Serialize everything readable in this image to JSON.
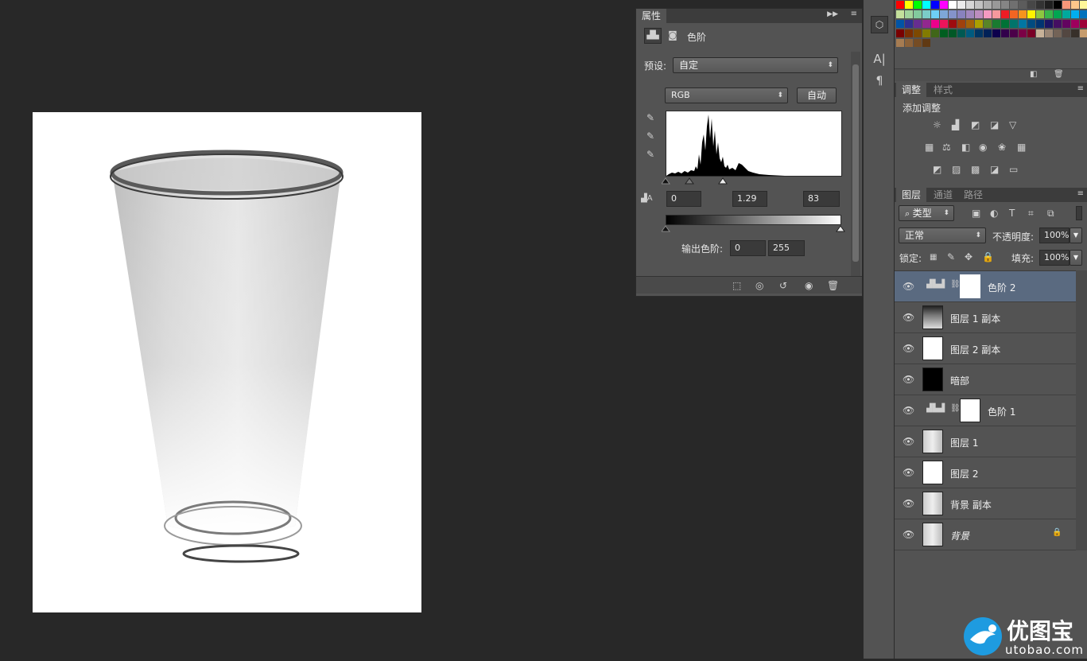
{
  "document": {
    "content": "glass-photo"
  },
  "properties_panel": {
    "tabs": [
      "属性"
    ],
    "title": "色阶",
    "preset_label": "预设:",
    "preset_value": "自定",
    "channel_value": "RGB",
    "auto_button": "自动",
    "input_black": "0",
    "input_gamma": "1.29",
    "input_white": "83",
    "output_label": "输出色阶:",
    "output_black": "0",
    "output_white": "255"
  },
  "adjustments_panel": {
    "tabs": [
      "调整",
      "样式"
    ],
    "add_label": "添加调整"
  },
  "layers_panel": {
    "tabs": [
      "图层",
      "通道",
      "路径"
    ],
    "filter_type": "类型",
    "blend_mode": "正常",
    "opacity_label": "不透明度:",
    "opacity_value": "100%",
    "lock_label": "锁定:",
    "fill_label": "填充:",
    "fill_value": "100%",
    "layers": [
      {
        "name": "色阶 2",
        "kind": "adjustment",
        "selected": true
      },
      {
        "name": "图层 1 副本",
        "kind": "glass-dark"
      },
      {
        "name": "图层 2 副本",
        "kind": "white"
      },
      {
        "name": "暗部",
        "kind": "black"
      },
      {
        "name": "色阶 1",
        "kind": "adjustment"
      },
      {
        "name": "图层 1",
        "kind": "glass"
      },
      {
        "name": "图层 2",
        "kind": "white"
      },
      {
        "name": "背景 副本",
        "kind": "glass"
      },
      {
        "name": "背景",
        "kind": "glass",
        "locked": true
      }
    ]
  },
  "watermark": {
    "brand": "优图宝",
    "url": "utobao.com"
  },
  "colors": {
    "panel_bg": "#535353",
    "canvas_bg": "#282828",
    "selected_layer": "#5a6a80",
    "watermark_blue": "#1e9be0"
  }
}
